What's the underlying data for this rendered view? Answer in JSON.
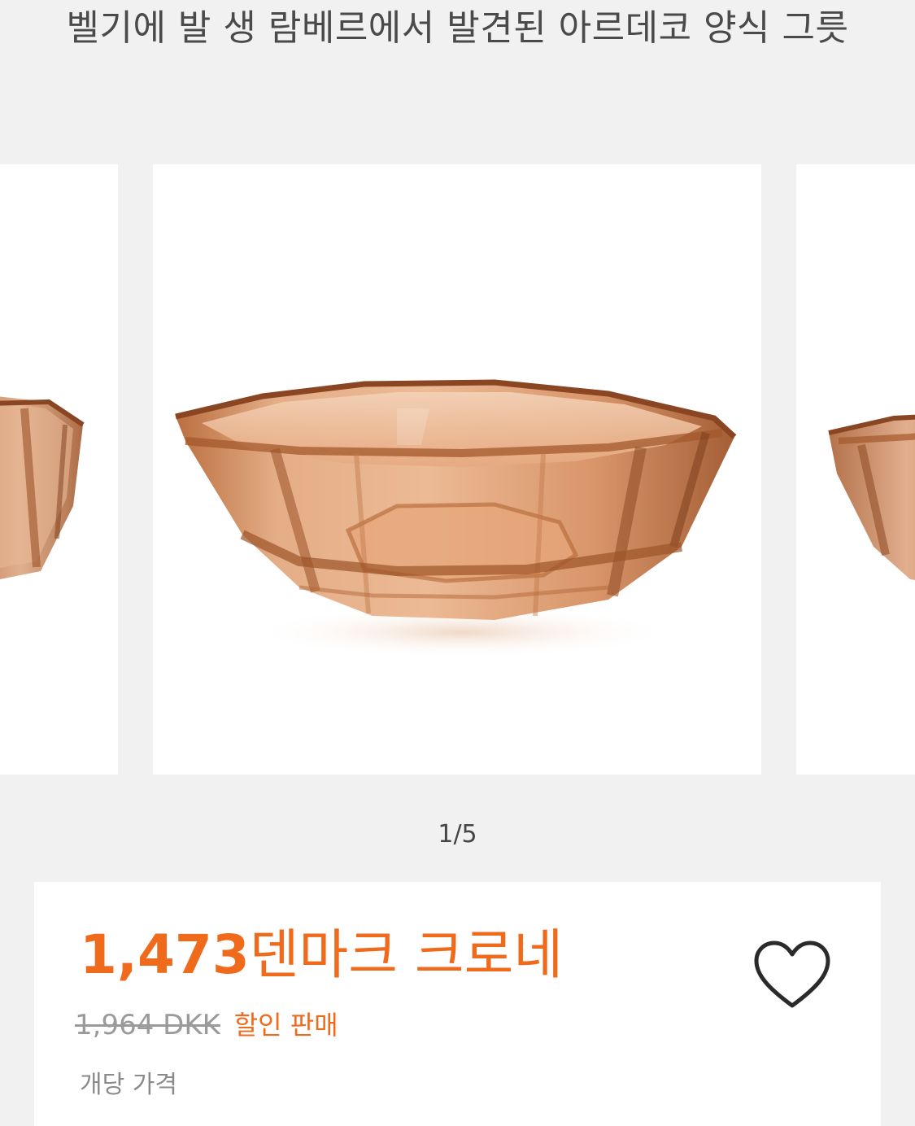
{
  "product": {
    "title": "벨기에 발 생 람베르에서 발견된 아르데코 양식 그릇"
  },
  "gallery": {
    "counter": "1/5",
    "accent_color": "#c77a45"
  },
  "pricing": {
    "amount": "1,473",
    "currency_label": "덴마크 크로네",
    "original_price": "1,964 DKK",
    "discount_label": "할인 판매",
    "unit_label": "개당 가격",
    "accent_color": "#f06a1c"
  },
  "icons": {
    "favorite": "heart-outline-icon"
  }
}
